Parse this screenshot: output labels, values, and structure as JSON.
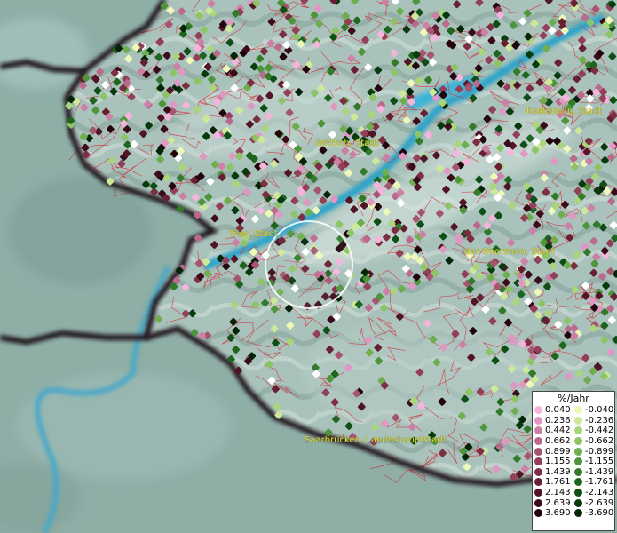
{
  "map": {
    "cities": [
      {
        "name": "Kastellaun, Stadt"
      },
      {
        "name": "Wittlich, Stadt"
      },
      {
        "name": "Trier, Stadt"
      },
      {
        "name": "Idar-Oberstein, Stadt"
      },
      {
        "name": "Saarbrücken, Landeshauptstadt"
      }
    ],
    "colors": {
      "water": "#2ea3c8",
      "border": "#1a0f12",
      "boundaries": "#d4323c",
      "highlight_ring": "#ffffff"
    }
  },
  "legend": {
    "title": "%/Jahr",
    "positive": [
      {
        "label": "0.040",
        "color": "#f4b4dc"
      },
      {
        "label": "0.236",
        "color": "#e197c3"
      },
      {
        "label": "0.442",
        "color": "#cd80a6"
      },
      {
        "label": "0.662",
        "color": "#ba6a8d"
      },
      {
        "label": "0.899",
        "color": "#a5556f"
      },
      {
        "label": "1.155",
        "color": "#914058"
      },
      {
        "label": "1.439",
        "color": "#7c2e42"
      },
      {
        "label": "1.761",
        "color": "#672032"
      },
      {
        "label": "2.143",
        "color": "#521525"
      },
      {
        "label": "2.639",
        "color": "#3a0b18"
      },
      {
        "label": "3.690",
        "color": "#22040c"
      }
    ],
    "negative": [
      {
        "label": "-0.040",
        "color": "#eef8b8"
      },
      {
        "label": "-0.236",
        "color": "#cde89a"
      },
      {
        "label": "-0.442",
        "color": "#a9d57d"
      },
      {
        "label": "-0.662",
        "color": "#8cc466"
      },
      {
        "label": "-0.899",
        "color": "#6eae4f"
      },
      {
        "label": "-1.155",
        "color": "#4e953b"
      },
      {
        "label": "-1.439",
        "color": "#337b2a"
      },
      {
        "label": "-1.761",
        "color": "#1e6520"
      },
      {
        "label": "-2.143",
        "color": "#0f4f15"
      },
      {
        "label": "-2.639",
        "color": "#073a0d"
      },
      {
        "label": "-3.690",
        "color": "#032406"
      }
    ]
  }
}
